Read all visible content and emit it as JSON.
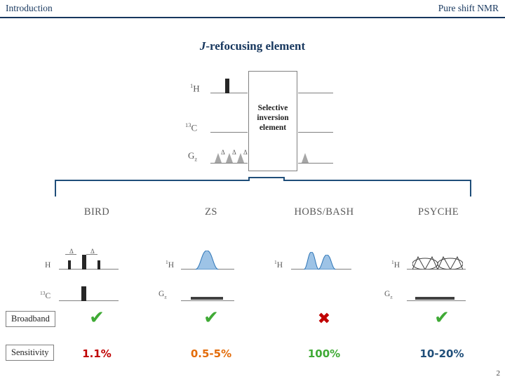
{
  "header": {
    "left": "Introduction",
    "right": "Pure shift NMR"
  },
  "title": {
    "italic_part": "J",
    "rest": "-refocusing element"
  },
  "top_diagram": {
    "channels": [
      {
        "label_main": "H",
        "label_sup": "1"
      },
      {
        "label_main": "C",
        "label_sup": "13"
      },
      {
        "label_main": "G",
        "label_sub": "z"
      }
    ],
    "box_lines": [
      "Selective",
      "inversion",
      "element"
    ],
    "gradient_deltas": [
      "Δ",
      "Δ",
      "Δ"
    ]
  },
  "methods": [
    {
      "name": "BIRD",
      "channels": [
        {
          "label_main": "H",
          "label_sup": ""
        },
        {
          "label_main": "C",
          "label_sup": "13"
        }
      ],
      "deltas": [
        "Δ",
        "Δ"
      ]
    },
    {
      "name": "ZS",
      "channels": [
        {
          "label_main": "H",
          "label_sup": "1"
        },
        {
          "label_main": "G",
          "label_sub": "z"
        }
      ],
      "deltas": []
    },
    {
      "name": "HOBS/BASH",
      "channels": [
        {
          "label_main": "H",
          "label_sup": "1"
        }
      ],
      "deltas": []
    },
    {
      "name": "PSYCHE",
      "channels": [
        {
          "label_main": "H",
          "label_sup": "1"
        },
        {
          "label_main": "G",
          "label_sub": "z"
        }
      ],
      "deltas": []
    }
  ],
  "rows": {
    "broadband_label": "Broadband",
    "sensitivity_label": "Sensitivity",
    "broadband_marks": [
      "✔",
      "✔",
      "✖",
      "✔"
    ],
    "sensitivity_values": [
      "1.1%",
      "0.5-5%",
      "100%",
      "10-20%"
    ]
  },
  "colors": {
    "tick_green": "#3faa35",
    "cross_red": "#c00000",
    "header_blue": "#17375e",
    "bracket_blue": "#1f4e79",
    "sens_1": "#c00000",
    "sens_2": "#e36c0a",
    "sens_3": "#3faa35",
    "sens_4": "#1f4e79"
  },
  "page_number": "2"
}
